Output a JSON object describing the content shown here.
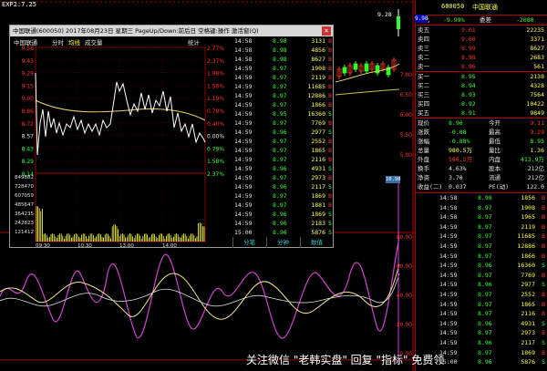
{
  "main": {
    "topbar_label": "EXP2:7.25",
    "price_badge": "9.28",
    "price_box": "9.98",
    "y_ticks": [
      "7.00",
      "6.50",
      "6.00",
      "5.50",
      "5.00",
      "80.00",
      "60.00",
      "40.00",
      "20.00",
      "0.00"
    ],
    "side_badge": "10.98"
  },
  "popup": {
    "title": "中国联通(600050) 2017年08月23日 星期三 PageUp/Down:前后日 空格键:操作 激活窗(Q)",
    "close": "×",
    "header_name": "中国联通",
    "header_tabs": [
      "分时",
      "均线",
      "成交量"
    ],
    "header_right": "统计",
    "price_levels_left": [
      "9.58",
      "9.43",
      "9.29",
      "9.15",
      "9.00",
      "8.86",
      "8.72",
      "8.57",
      "8.43",
      "8.29",
      "8.14"
    ],
    "pct_levels_right": [
      "2.77%",
      "2.37%",
      "1.98%",
      "1.58%",
      "1.19%",
      "0.79%",
      "0.40%",
      "0.00%",
      "0.79%",
      "1.58%",
      "2.37%"
    ],
    "volume_levels": [
      "849882",
      "728470",
      "607059",
      "485647",
      "364235",
      "242823",
      "121412"
    ],
    "time_labels": [
      "09:30",
      "10:30",
      "13:00",
      "14:00"
    ],
    "ticks": [
      {
        "time": "14:58",
        "price": "8.98",
        "vol": "3131",
        "bs": "B"
      },
      {
        "time": "14:58",
        "price": "8.98",
        "vol": "4856",
        "bs": "B"
      },
      {
        "time": "14:58",
        "price": "8.98",
        "vol": "8627",
        "bs": "B"
      },
      {
        "time": "14:59",
        "price": "8.97",
        "vol": "1908",
        "bs": "B"
      },
      {
        "time": "14:59",
        "price": "8.97",
        "vol": "2119",
        "bs": "B"
      },
      {
        "time": "14:59",
        "price": "8.97",
        "vol": "11685",
        "bs": "B"
      },
      {
        "time": "14:59",
        "price": "8.97",
        "vol": "12886",
        "bs": "B"
      },
      {
        "time": "14:59",
        "price": "8.97",
        "vol": "1866",
        "bs": "B"
      },
      {
        "time": "14:59",
        "price": "8.95",
        "vol": "16360",
        "bs": "S"
      },
      {
        "time": "14:59",
        "price": "8.97",
        "vol": "7769",
        "bs": "B"
      },
      {
        "time": "14:59",
        "price": "8.96",
        "vol": "2977",
        "bs": "S"
      },
      {
        "time": "14:59",
        "price": "8.97",
        "vol": "2552",
        "bs": "B"
      },
      {
        "time": "14:59",
        "price": "8.97",
        "vol": "1865",
        "bs": "B"
      },
      {
        "time": "14:59",
        "price": "8.97",
        "vol": "2116",
        "bs": "B"
      },
      {
        "time": "14:59",
        "price": "8.96",
        "vol": "4931",
        "bs": "S"
      },
      {
        "time": "14:59",
        "price": "8.97",
        "vol": "2973",
        "bs": "B"
      },
      {
        "time": "14:59",
        "price": "8.96",
        "vol": "2117",
        "bs": "S"
      },
      {
        "time": "14:59",
        "price": "8.97",
        "vol": "1869",
        "bs": "B"
      },
      {
        "time": "14:59",
        "price": "8.97",
        "vol": "1881",
        "bs": "B"
      },
      {
        "time": "14:59",
        "price": "8.96",
        "vol": "1869",
        "bs": "S"
      },
      {
        "time": "14:59",
        "price": "8.96",
        "vol": "2183",
        "bs": "S"
      },
      {
        "time": "15:00",
        "price": "8.96",
        "vol": "5876",
        "bs": "S"
      }
    ],
    "tabs": [
      "分笔",
      "分钟",
      "数值"
    ]
  },
  "right": {
    "code": "600050",
    "name": "中国联通",
    "weibi": {
      "label": "委比",
      "value": "-9.99%",
      "label2": "委差",
      "value2": "-2080"
    },
    "asks": [
      {
        "label": "卖五",
        "price": "9.01",
        "vol": "22235"
      },
      {
        "label": "卖四",
        "price": "9.00",
        "vol": "3371"
      },
      {
        "label": "卖三",
        "price": "8.99",
        "vol": "8627"
      },
      {
        "label": "卖二",
        "price": "8.98",
        "vol": "2683"
      },
      {
        "label": "卖一",
        "price": "8.96",
        "vol": "561"
      }
    ],
    "bids": [
      {
        "label": "买一",
        "price": "8.95",
        "vol": "2138"
      },
      {
        "label": "买二",
        "price": "8.94",
        "vol": "4328"
      },
      {
        "label": "买三",
        "price": "8.93",
        "vol": "7564"
      },
      {
        "label": "买四",
        "price": "8.92",
        "vol": "10422"
      },
      {
        "label": "买五",
        "price": "8.91",
        "vol": "9849"
      }
    ],
    "stats": [
      {
        "l1": "现价",
        "v1": "8.96",
        "l2": "今开",
        "v2": "9.11"
      },
      {
        "l1": "涨跌",
        "v1": "-0.08",
        "l2": "最高",
        "v2": "9.29"
      },
      {
        "l1": "涨幅",
        "v1": "-0.88%",
        "l2": "最低",
        "v2": "8.95"
      },
      {
        "l1": "总量",
        "v1": "980.5万",
        "l2": "量比",
        "v2": "1.36"
      },
      {
        "l1": "外盘",
        "v1": "566.5万",
        "l2": "内盘",
        "v2": "413.9万"
      },
      {
        "l1": "换手",
        "v1": "4.63%",
        "l2": "股本",
        "v2": "212亿"
      },
      {
        "l1": "净资",
        "v1": "3.70",
        "l2": "流通",
        "v2": "212亿"
      },
      {
        "l1": "收益(二)",
        "v1": "0.037",
        "l2": "PE(动)",
        "v2": "122.0"
      }
    ],
    "ticks": [
      {
        "time": "14:58",
        "price": "8.98",
        "vol": "1856",
        "bs": "B"
      },
      {
        "time": "14:58",
        "price": "8.97",
        "vol": "1908",
        "bs": "B"
      },
      {
        "time": "14:58",
        "price": "8.97",
        "vol": "1965",
        "bs": "B"
      },
      {
        "time": "14:59",
        "price": "8.97",
        "vol": "2119",
        "bs": "B"
      },
      {
        "time": "14:59",
        "price": "8.97",
        "vol": "11685",
        "bs": "B"
      },
      {
        "time": "14:59",
        "price": "8.97",
        "vol": "12886",
        "bs": "B"
      },
      {
        "time": "14:59",
        "price": "8.97",
        "vol": "1866",
        "bs": "B"
      },
      {
        "time": "14:59",
        "price": "8.96",
        "vol": "16360",
        "bs": "S"
      },
      {
        "time": "14:59",
        "price": "8.97",
        "vol": "7769",
        "bs": "B"
      },
      {
        "time": "14:59",
        "price": "8.96",
        "vol": "2977",
        "bs": "S"
      },
      {
        "time": "14:59",
        "price": "8.97",
        "vol": "2552",
        "bs": "B"
      },
      {
        "time": "14:59",
        "price": "8.97",
        "vol": "1865",
        "bs": "B"
      },
      {
        "time": "14:59",
        "price": "8.97",
        "vol": "2116",
        "bs": "B"
      },
      {
        "time": "14:59",
        "price": "8.96",
        "vol": "4931",
        "bs": "S"
      },
      {
        "time": "14:59",
        "price": "8.97",
        "vol": "2973",
        "bs": "B"
      },
      {
        "time": "14:59",
        "price": "8.96",
        "vol": "2117",
        "bs": "S"
      },
      {
        "time": "14:59",
        "price": "8.97",
        "vol": "1869",
        "bs": "B"
      },
      {
        "time": "15:00",
        "price": "8.96",
        "vol": "5876",
        "bs": "S"
      }
    ]
  },
  "watermark": "关注微信 \"老韩实盘\" 回复 \"指标\" 免费领",
  "colors": {
    "up": "#ff3030",
    "down": "#30ff30",
    "vol": "#ffff44",
    "line1": "#ffffff",
    "line2": "#e6d36a",
    "osc1": "#cc44cc",
    "osc2": "#f0e68c",
    "frame": "#aa0000"
  }
}
